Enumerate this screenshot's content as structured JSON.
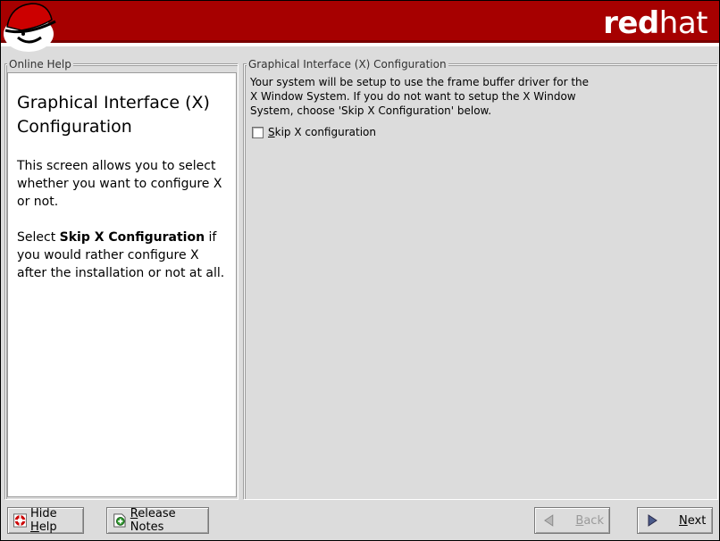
{
  "header": {
    "brand_bold": "red",
    "brand_light": "hat",
    "logo_icon": "shadowman-hat-icon",
    "colors": {
      "banner": "#a60000",
      "stripe": "#7a0000"
    }
  },
  "help": {
    "group_label": "Online Help",
    "heading": "Graphical Interface (X) Configuration",
    "paragraph1": "This screen allows you to select whether you want to configure X or not.",
    "paragraph2_prefix": "Select ",
    "paragraph2_bold": "Skip X Configuration",
    "paragraph2_suffix": " if you would rather configure X after the installation or not at all."
  },
  "config": {
    "group_label": "Graphical Interface (X) Configuration",
    "description": "Your system will be setup to use the frame buffer driver for the X Window System.  If you do not want to setup the X Window System, choose 'Skip X Configuration' below.",
    "skip_checkbox": {
      "mnemonic": "S",
      "label_rest": "kip X configuration",
      "checked": false
    }
  },
  "buttons": {
    "hide_help": {
      "pre": "Hide ",
      "mnemonic": "H",
      "post": "elp",
      "icon": "lifebuoy-icon"
    },
    "release_notes": {
      "mnemonic": "R",
      "post": "elease Notes",
      "icon": "notes-add-icon"
    },
    "back": {
      "mnemonic": "B",
      "post": "ack",
      "icon": "left-arrow-icon",
      "enabled": false
    },
    "next": {
      "mnemonic": "N",
      "post": "ext",
      "icon": "right-arrow-icon",
      "enabled": true
    }
  }
}
